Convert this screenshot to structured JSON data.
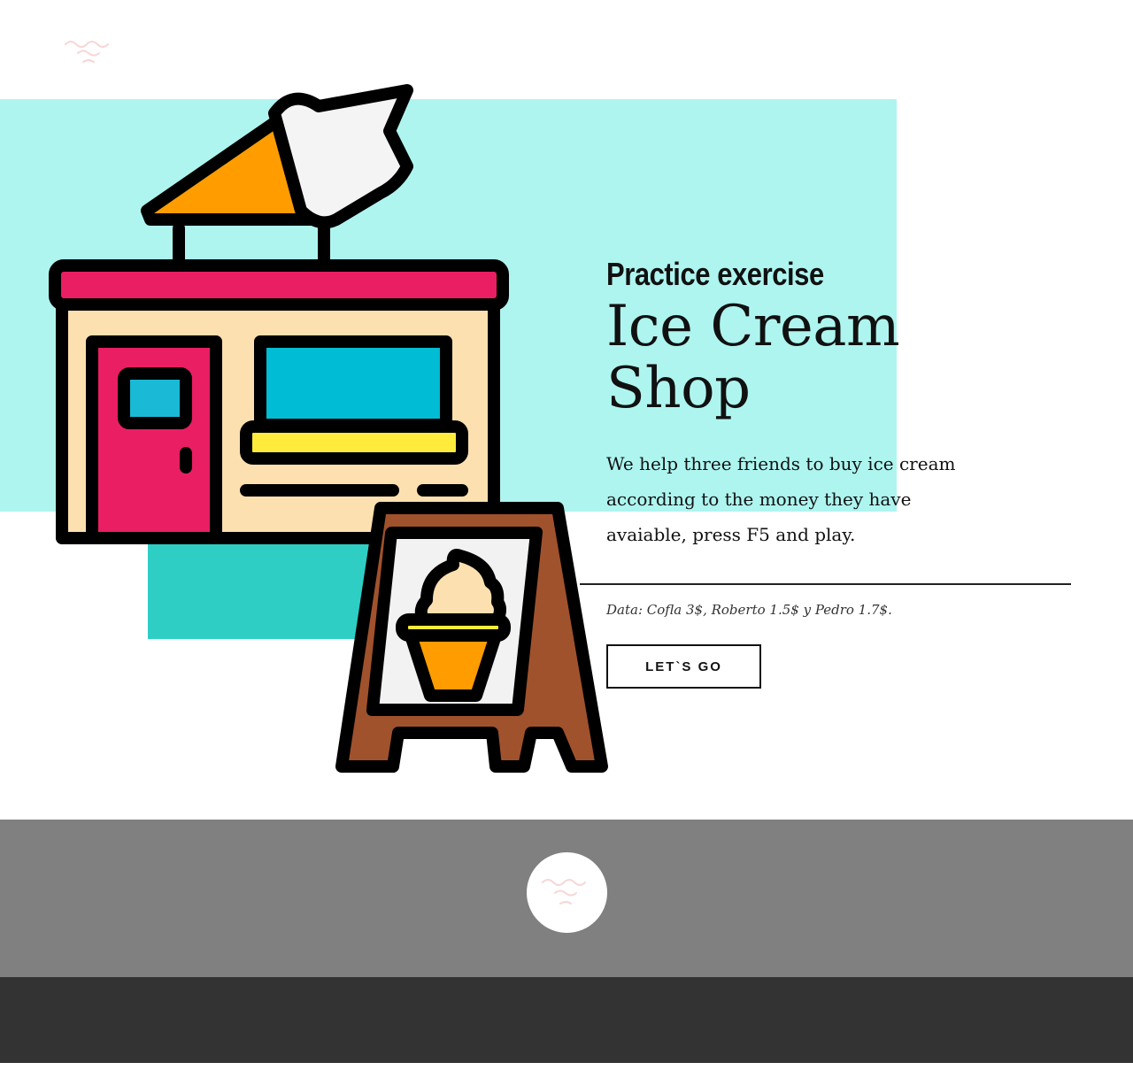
{
  "brand": {
    "logo_icon": "developer-hub-logo-icon",
    "footer_logo_icon": "developer-hub-logo-icon"
  },
  "hero": {
    "eyebrow": "Practice exercise",
    "title_line1": "Ice Cream",
    "title_line2": "Shop",
    "description": "We help three friends to buy ice cream according to the money they have avaiable, press F5 and play.",
    "data_note": "Data: Cofla 3$, Roberto 1.5$ y Pedro 1.7$.",
    "cta_label": "LET`S GO",
    "illustration_icon": "ice-cream-shop-illustration"
  },
  "colors": {
    "aqua_background": "#aef5f0",
    "teal_block": "#2ecec5",
    "footer_mid": "#808080",
    "footer_bottom": "#333333"
  }
}
